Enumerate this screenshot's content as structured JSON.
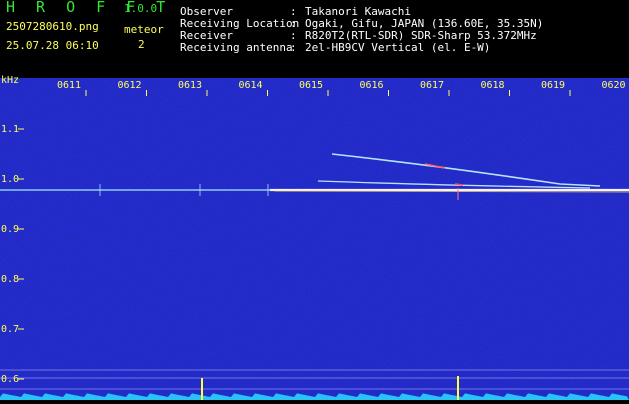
{
  "header": {
    "logo": "H R O F F T",
    "version": "1.0.0",
    "filename": "2507280610.png",
    "event_label": "meteor",
    "event_count": "2",
    "datetime": "25.07.28 06:10",
    "info": [
      {
        "label": "Observer",
        "value": "Takanori Kawachi"
      },
      {
        "label": "Receiving Location",
        "value": "Ogaki, Gifu, JAPAN (136.60E, 35.35N)"
      },
      {
        "label": "Receiver",
        "value": "R820T2(RTL-SDR) SDR-Sharp 53.372MHz"
      },
      {
        "label": "Receiving antenna",
        "value": "2el-HB9CV Vertical (el. E-W)"
      }
    ],
    "separator": ":"
  },
  "spectrogram": {
    "y_unit": "kHz",
    "x_ticks": [
      "0611",
      "0612",
      "0613",
      "0614",
      "0615",
      "0616",
      "0617",
      "0618",
      "0619",
      "0620"
    ],
    "y_ticks": [
      "1.1",
      "1.0",
      "0.9",
      "0.8",
      "0.7",
      "0.6"
    ],
    "colors": {
      "background": "#000000",
      "noise": "#0a0a70",
      "carrier": "#c8ffff",
      "text": "#ffff5a",
      "title": "#32e632"
    }
  }
}
